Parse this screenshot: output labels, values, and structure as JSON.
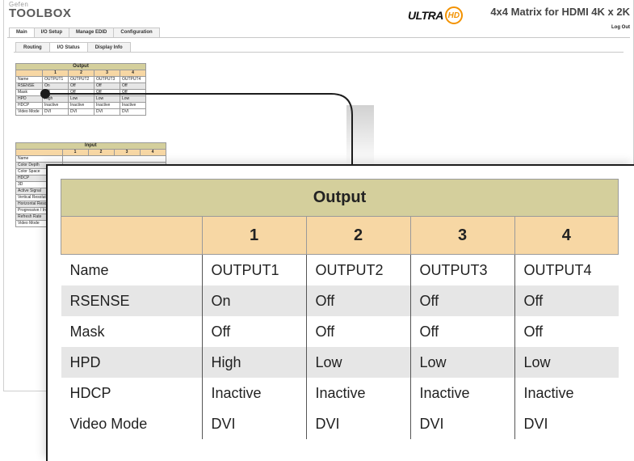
{
  "brand": {
    "top": "Gefen",
    "name": "TOOLBOX"
  },
  "logo": {
    "ultra": "ULTRA",
    "hd": "HD"
  },
  "product_title": "4x4 Matrix for HDMI 4K x 2K",
  "logout": "Log Out",
  "main_tabs": [
    "Main",
    "I/O Setup",
    "Manage EDID",
    "Configuration"
  ],
  "sub_tabs": [
    "Routing",
    "I/O Status",
    "Display Info"
  ],
  "output_table": {
    "title": "Output",
    "columns": [
      "1",
      "2",
      "3",
      "4"
    ],
    "rows": [
      {
        "label": "Name",
        "values": [
          "OUTPUT1",
          "OUTPUT2",
          "OUTPUT3",
          "OUTPUT4"
        ]
      },
      {
        "label": "RSENSE",
        "values": [
          "On",
          "Off",
          "Off",
          "Off"
        ]
      },
      {
        "label": "Mask",
        "values": [
          "Off",
          "Off",
          "Off",
          "Off"
        ]
      },
      {
        "label": "HPD",
        "values": [
          "High",
          "Low",
          "Low",
          "Low"
        ]
      },
      {
        "label": "HDCP",
        "values": [
          "Inactive",
          "Inactive",
          "Inactive",
          "Inactive"
        ]
      },
      {
        "label": "Video Mode",
        "values": [
          "DVI",
          "DVI",
          "DVI",
          "DVI"
        ]
      }
    ]
  },
  "input_table": {
    "title": "Input",
    "columns": [
      "1",
      "2",
      "3",
      "4"
    ],
    "rows": [
      "Name",
      "Color Depth",
      "Color Space",
      "HDCP",
      "3D",
      "Active Signal",
      "Vertical Resolution",
      "Horizontal Resolution",
      "Progressive / Interlaced",
      "Refresh Rate",
      "Video Mode"
    ]
  },
  "colors": {
    "title_bg": "#d4cf9c",
    "header_bg": "#f7d7a4",
    "shaded_row": "#e6e6e6",
    "hd_orange": "#f39200"
  }
}
